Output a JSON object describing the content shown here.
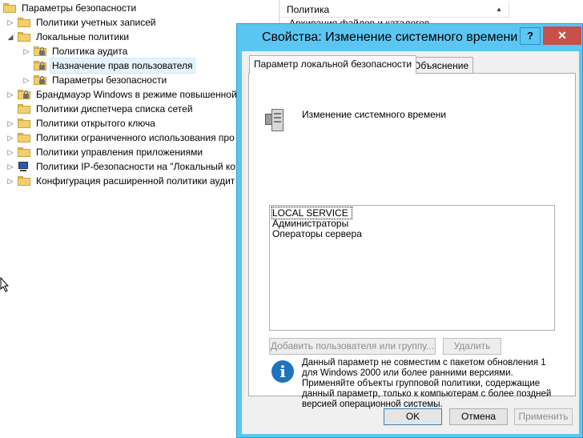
{
  "tree": {
    "items": [
      {
        "label": "Параметры безопасности",
        "level": 0,
        "expanded": true,
        "icon": "shield-folder-icon"
      },
      {
        "label": "Политики учетных записей",
        "level": 1,
        "expanded": false,
        "icon": "folder-icon"
      },
      {
        "label": "Локальные политики",
        "level": 1,
        "expanded": true,
        "icon": "folder-icon"
      },
      {
        "label": "Политика аудита",
        "level": 2,
        "expanded": false,
        "icon": "locked-folder-icon"
      },
      {
        "label": "Назначение прав пользователя",
        "level": 2,
        "expanded": false,
        "icon": "locked-folder-icon",
        "selected": true
      },
      {
        "label": "Параметры безопасности",
        "level": 2,
        "expanded": false,
        "icon": "locked-folder-icon"
      },
      {
        "label": "Брандмауэр Windows в режиме повышенной",
        "level": 1,
        "expanded": false,
        "icon": "locked-folder-icon"
      },
      {
        "label": "Политики диспетчера списка сетей",
        "level": 1,
        "expanded": false,
        "icon": "folder-icon"
      },
      {
        "label": "Политики открытого ключа",
        "level": 1,
        "expanded": false,
        "icon": "folder-icon"
      },
      {
        "label": "Политики ограниченного использования про",
        "level": 1,
        "expanded": false,
        "icon": "folder-icon"
      },
      {
        "label": "Политики управления приложениями",
        "level": 1,
        "expanded": false,
        "icon": "folder-icon"
      },
      {
        "label": "Политики IP-безопасности на \"Локальный ко",
        "level": 1,
        "expanded": false,
        "icon": "computer-icon"
      },
      {
        "label": "Конфигурация расширенной политики аудит",
        "level": 1,
        "expanded": false,
        "icon": "folder-icon"
      }
    ]
  },
  "list": {
    "column_header": "Политика",
    "first_row": "Архивация файлов и каталогов"
  },
  "dialog": {
    "title": "Свойства: Изменение системного времени",
    "help_label": "?",
    "close_label": "✕",
    "tabs": [
      {
        "label": "Параметр локальной безопасности",
        "active": true
      },
      {
        "label": "Объяснение",
        "active": false
      }
    ],
    "policy_name": "Изменение системного времени",
    "users": [
      "LOCAL SERVICE",
      "Администраторы",
      "Операторы сервера"
    ],
    "add_button": "Добавить пользователя или группу...",
    "remove_button": "Удалить",
    "info_text": "Данный параметр не совместим с пакетом обновления 1 для Windows 2000 или более ранними версиями. Применяйте объекты групповой политики, содержащие данный параметр, только к компьютерам с более поздней версией операционной системы.",
    "ok_button": "OK",
    "cancel_button": "Отмена",
    "apply_button": "Применить"
  }
}
